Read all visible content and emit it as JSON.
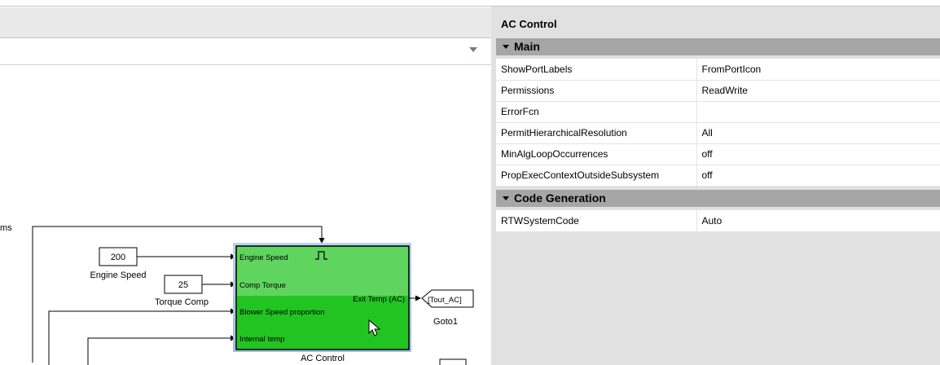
{
  "canvas": {
    "partial_label": "ms",
    "blocks": {
      "const_200": {
        "value": "200",
        "caption": "Engine Speed"
      },
      "const_25": {
        "value": "25",
        "caption": "Torque Comp"
      },
      "subsystem": {
        "caption": "AC Control",
        "inputs": [
          "Engine Speed",
          "Comp Torque",
          "Blower Speed proportion",
          "Internal temp"
        ],
        "output": "Exit Temp (AC)",
        "fill_color": "#22c422"
      },
      "goto": {
        "tag": "[Tout_AC]",
        "caption": "Goto1"
      }
    }
  },
  "property_panel": {
    "title": "AC Control",
    "sections": [
      {
        "label": "Main",
        "rows": [
          {
            "key": "ShowPortLabels",
            "value": "FromPortIcon"
          },
          {
            "key": "Permissions",
            "value": "ReadWrite"
          },
          {
            "key": "ErrorFcn",
            "value": ""
          },
          {
            "key": "PermitHierarchicalResolution",
            "value": "All"
          },
          {
            "key": "MinAlgLoopOccurrences",
            "value": "off"
          },
          {
            "key": "PropExecContextOutsideSubsystem",
            "value": "off"
          }
        ]
      },
      {
        "label": "Code Generation",
        "rows": [
          {
            "key": "RTWSystemCode",
            "value": "Auto"
          }
        ]
      }
    ]
  },
  "icons": {
    "dropdown": "chevron-down-icon",
    "trigger": "trigger-pulse-icon",
    "cursor": "mouse-pointer-icon",
    "section_toggle": "collapse-triangle-icon"
  }
}
